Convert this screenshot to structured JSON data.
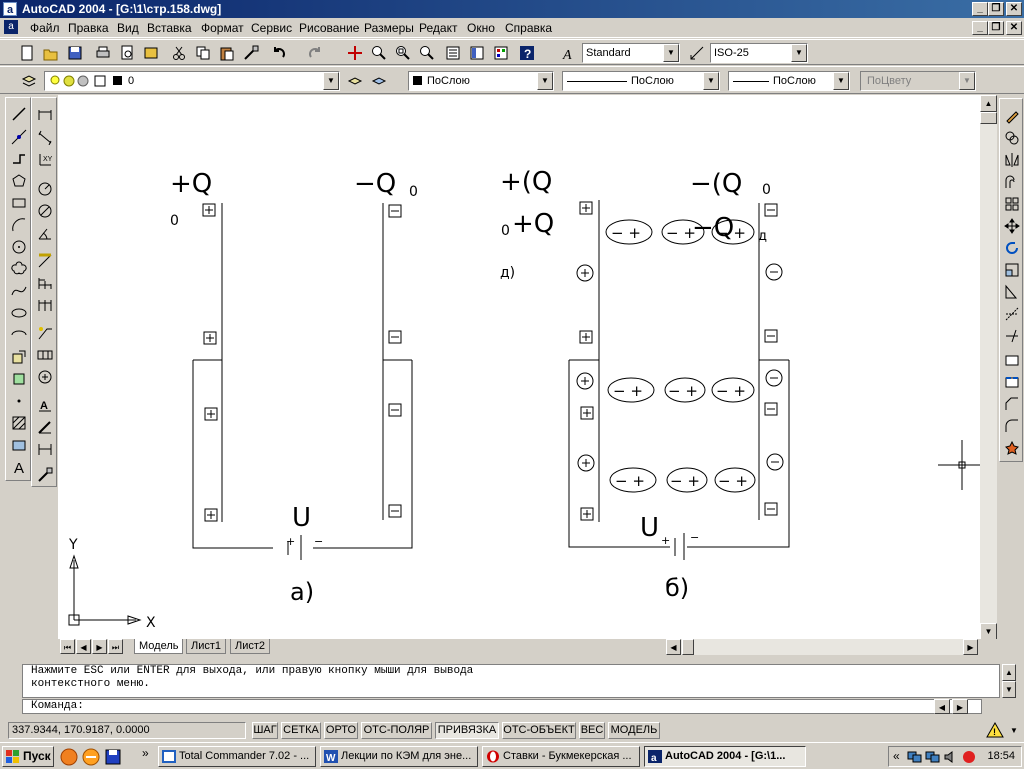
{
  "window": {
    "title": "AutoCAD 2004 - [G:\\1\\стр.158.dwg]",
    "app_icon": "a"
  },
  "menu": {
    "items": [
      "Файл",
      "Правка",
      "Вид",
      "Вставка",
      "Формат",
      "Сервис",
      "Рисование",
      "Размеры",
      "Редакт",
      "Окно",
      "Справка"
    ]
  },
  "toolbar_styles": {
    "text_style": "Standard",
    "dim_style": "ISO-25"
  },
  "toolbar_layers": {
    "layer": "0",
    "color": "ПоСлою",
    "linetype": "ПоСлою",
    "lineweight": "ПоСлою",
    "plotstyle": "ПоЦвету"
  },
  "drawing": {
    "left_circuit": {
      "label_pos": "+Q",
      "label_pos_sub": "0",
      "label_neg": "−Q",
      "label_neg_sub": "0",
      "voltage": "U",
      "caption": "а)"
    },
    "right_circuit": {
      "label_pos": "+(Q",
      "label_pos_sub": "0",
      "label_pos2": "+Q",
      "label_pos2_sub": "д)",
      "label_neg": "−(Q",
      "label_neg_sub": "0",
      "label_neg2": "−Q",
      "label_neg2_sub": "д",
      "voltage": "U",
      "caption": "б)"
    },
    "dipole_text": "− +",
    "plus_sign": "+",
    "minus_sign": "−",
    "axis_x": "X",
    "axis_y": "Y"
  },
  "layout_tabs": [
    "Модель",
    "Лист1",
    "Лист2"
  ],
  "command": {
    "history_line1": "Нажмите ESC или ENTER для выхода, или правую кнопку мыши для вывода",
    "history_line2": "контекстного меню.",
    "prompt": "Команда:"
  },
  "status": {
    "coords": "337.9344, 170.9187, 0.0000",
    "toggles": [
      {
        "label": "ШАГ",
        "on": false
      },
      {
        "label": "СЕТКА",
        "on": false
      },
      {
        "label": "ОРТО",
        "on": false
      },
      {
        "label": "ОТС-ПОЛЯР",
        "on": false
      },
      {
        "label": "ПРИВЯЗКА",
        "on": true
      },
      {
        "label": "ОТС-ОБЪЕКТ",
        "on": false
      },
      {
        "label": "ВЕС",
        "on": false
      },
      {
        "label": "МОДЕЛЬ",
        "on": false
      }
    ]
  },
  "taskbar": {
    "start": "Пуск",
    "tasks": [
      {
        "label": "Total Commander 7.02 - ...",
        "active": false
      },
      {
        "label": "Лекции по КЭМ для эне...",
        "active": false
      },
      {
        "label": "Ставки - Букмекерская ...",
        "active": false
      },
      {
        "label": "AutoCAD 2004 - [G:\\1...",
        "active": true
      }
    ],
    "clock": "18:54"
  },
  "colors": {
    "titlebar": "#0a246a",
    "drawing_bg": "#ffffff",
    "chrome": "#d4d0c8"
  }
}
